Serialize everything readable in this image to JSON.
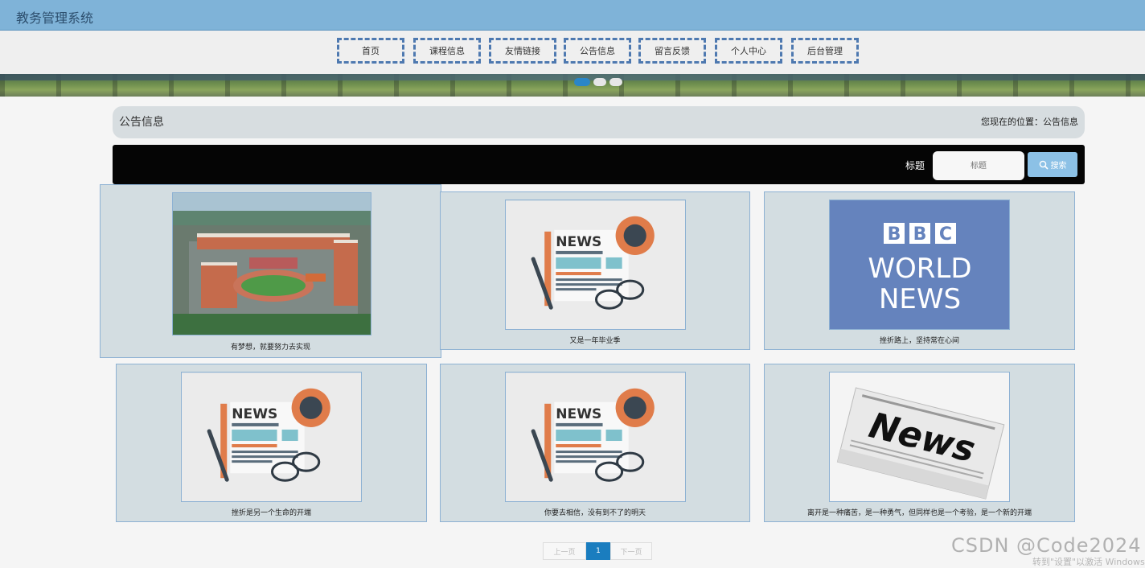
{
  "header": {
    "app_title": "教务管理系统"
  },
  "nav": {
    "items": [
      {
        "label": "首页"
      },
      {
        "label": "课程信息"
      },
      {
        "label": "友情链接"
      },
      {
        "label": "公告信息"
      },
      {
        "label": "留言反馈"
      },
      {
        "label": "个人中心"
      },
      {
        "label": "后台管理"
      }
    ]
  },
  "banner": {
    "slide_count": 3,
    "active_slide": 1
  },
  "section": {
    "title": "公告信息",
    "breadcrumb": "您现在的位置：公告信息"
  },
  "search": {
    "label": "标题",
    "placeholder": "标题",
    "button_label": "搜索",
    "button_icon": "search-icon"
  },
  "cards": [
    {
      "caption": "有梦想，就要努力去实现",
      "image": "campus-aerial-image"
    },
    {
      "caption": "又是一年毕业季",
      "image": "news-illustration-image"
    },
    {
      "caption": "挫折路上，坚持常在心间",
      "image": "bbc-world-news-image",
      "image_text": [
        "B",
        "B",
        "C",
        "WORLD",
        "NEWS"
      ]
    },
    {
      "caption": "挫折是另一个生命的开端",
      "image": "news-illustration-image"
    },
    {
      "caption": "你要去相信，没有到不了的明天",
      "image": "news-illustration-image"
    },
    {
      "caption": "离开是一种痛苦，是一种勇气，但同样也是一个考验，是一个新的开端",
      "image": "newspaper-image",
      "image_text": "News"
    }
  ],
  "news_illustration": {
    "text": "NEWS"
  },
  "pagination": {
    "prev": "上一页",
    "current": "1",
    "next": "下一页"
  },
  "watermark": {
    "text": "CSDN @Code2024",
    "activation": "转到\"设置\"以激活 Windows"
  },
  "colors": {
    "topbar": "#7fb3d8",
    "nav_border": "#4e79b0",
    "card_bg": "#d3dde1",
    "card_border": "#8db1d3",
    "search_bar": "#050505",
    "search_button": "#8cc1e6",
    "pager_active": "#1a7dbf"
  }
}
